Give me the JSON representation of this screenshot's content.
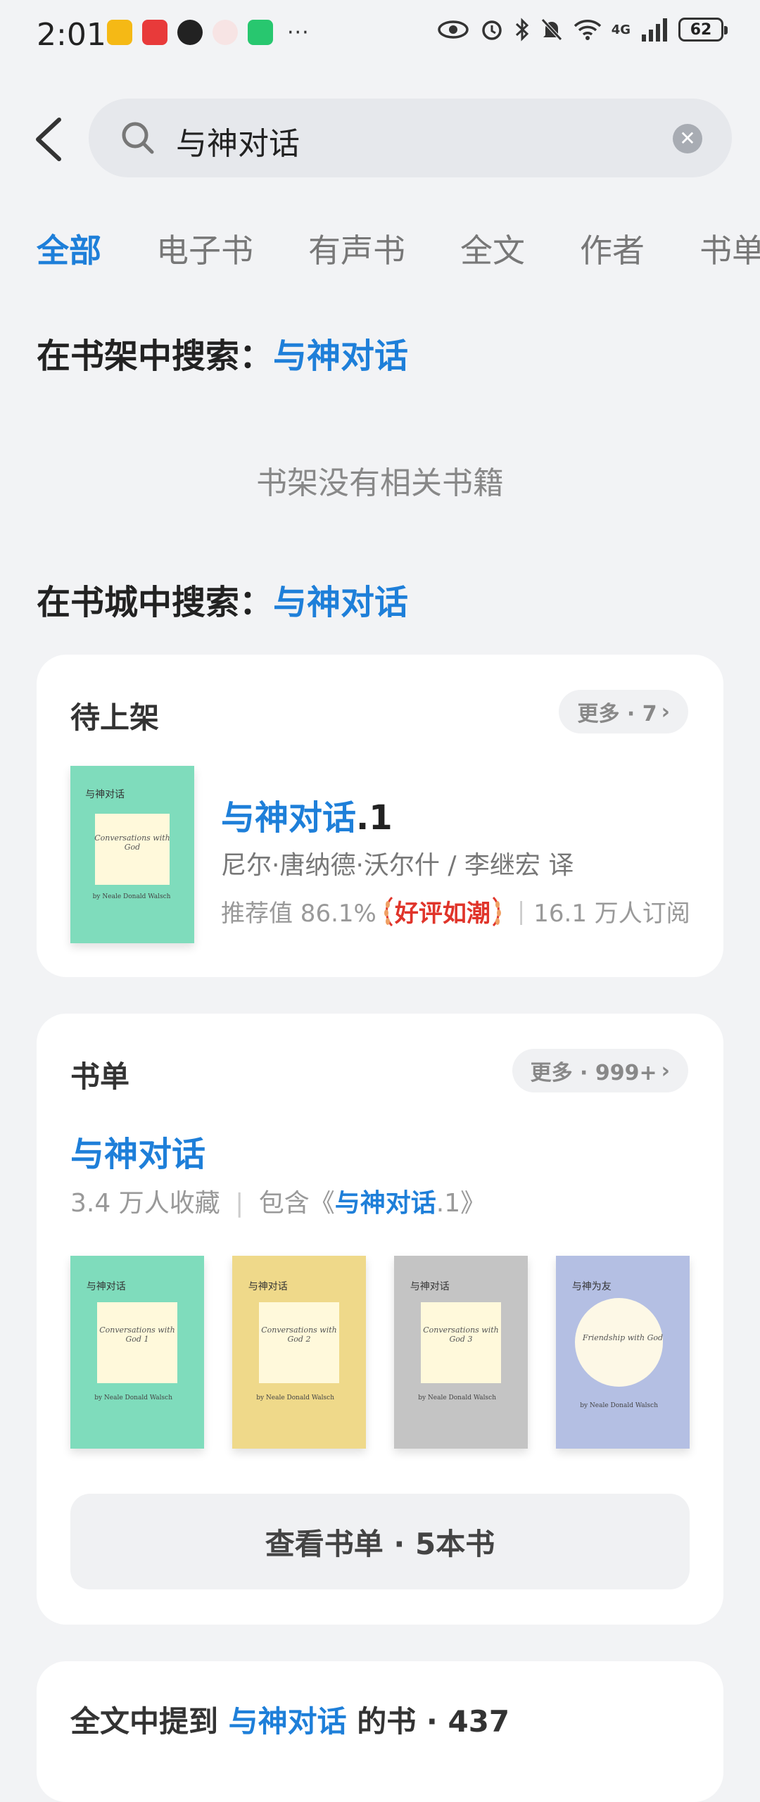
{
  "status": {
    "time": "2:01",
    "network": "4G",
    "battery": "62",
    "more": "···"
  },
  "search": {
    "query": "与神对话"
  },
  "tabs": [
    "全部",
    "电子书",
    "有声书",
    "全文",
    "作者",
    "书单"
  ],
  "shelf": {
    "label": "在书架中搜索：",
    "query": "与神对话",
    "empty": "书架没有相关书籍"
  },
  "store": {
    "label": "在书城中搜索：",
    "query": "与神对话"
  },
  "pending": {
    "title": "待上架",
    "more": "更多 · 7",
    "book": {
      "title_main": "与神对话",
      "title_suffix": ".1",
      "author": "尼尔·唐纳德·沃尔什 / 李继宏 译",
      "recommend": "推荐值 86.1%",
      "badge": "好评如潮",
      "subscribers": "16.1 万人订阅",
      "cover": {
        "title": "与神对话",
        "script": "Conversations with God",
        "by": "by Neale Donald Walsch",
        "color": "#7fdcbc"
      }
    }
  },
  "booklist": {
    "title": "书单",
    "more": "更多 · 999+",
    "list_title": "与神对话",
    "stats": "3.4 万人收藏",
    "contains_prefix": "包含《",
    "contains_name": "与神对话",
    "contains_suffix": ".1》",
    "covers": [
      {
        "title": "与神对话",
        "script": "Conversations with God 1",
        "by": "by Neale Donald Walsch",
        "color": "#7fdcbc"
      },
      {
        "title": "与神对话",
        "script": "Conversations with God 2",
        "by": "by Neale Donald Walsch",
        "color": "#efd98a"
      },
      {
        "title": "与神对话",
        "script": "Conversations with God 3",
        "by": "by Neale Donald Walsch",
        "color": "#c4c4c4"
      },
      {
        "title": "与神为友",
        "script": "Friendship with God",
        "by": "by Neale Donald Walsch",
        "color": "#b4bfe3"
      }
    ],
    "view_button": "查看书单 · 5本书"
  },
  "fulltext": {
    "prefix": "全文中提到",
    "query": "与神对话",
    "suffix": "的书 · 437"
  }
}
